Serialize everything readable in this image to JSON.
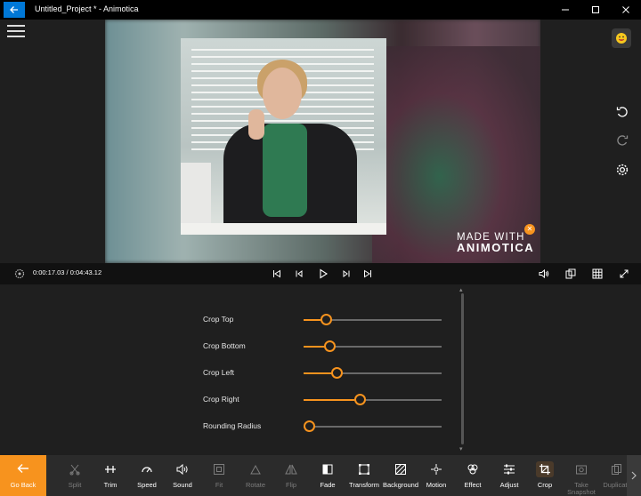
{
  "window": {
    "title": "Untitled_Project * - Animotica"
  },
  "preview": {
    "watermark_line1": "MADE WITH",
    "watermark_line2": "ANIMOTICA"
  },
  "playback": {
    "timecode": "0:00:17.03 / 0:04:43.12"
  },
  "crop_settings": [
    {
      "label": "Crop Top",
      "value": 0.12
    },
    {
      "label": "Crop Bottom",
      "value": 0.15
    },
    {
      "label": "Crop Left",
      "value": 0.2
    },
    {
      "label": "Crop Right",
      "value": 0.37
    },
    {
      "label": "Rounding Radius",
      "value": 0.0
    }
  ],
  "toolbar": {
    "go_back": "Go Back",
    "items": [
      {
        "label": "Split",
        "enabled": false
      },
      {
        "label": "Trim",
        "enabled": true
      },
      {
        "label": "Speed",
        "enabled": true
      },
      {
        "label": "Sound",
        "enabled": true
      },
      {
        "label": "Fit",
        "enabled": false
      },
      {
        "label": "Rotate",
        "enabled": false
      },
      {
        "label": "Flip",
        "enabled": false
      },
      {
        "label": "Fade",
        "enabled": true
      },
      {
        "label": "Transform",
        "enabled": true
      },
      {
        "label": "Background",
        "enabled": true
      },
      {
        "label": "Motion",
        "enabled": true
      },
      {
        "label": "Effect",
        "enabled": true
      },
      {
        "label": "Adjust",
        "enabled": true
      },
      {
        "label": "Crop",
        "enabled": true,
        "active": true
      },
      {
        "label": "Take Snapshot",
        "enabled": false
      },
      {
        "label": "Duplicate",
        "enabled": false
      }
    ]
  },
  "colors": {
    "accent": "#f7931e",
    "titlebar_back": "#0078d7"
  }
}
